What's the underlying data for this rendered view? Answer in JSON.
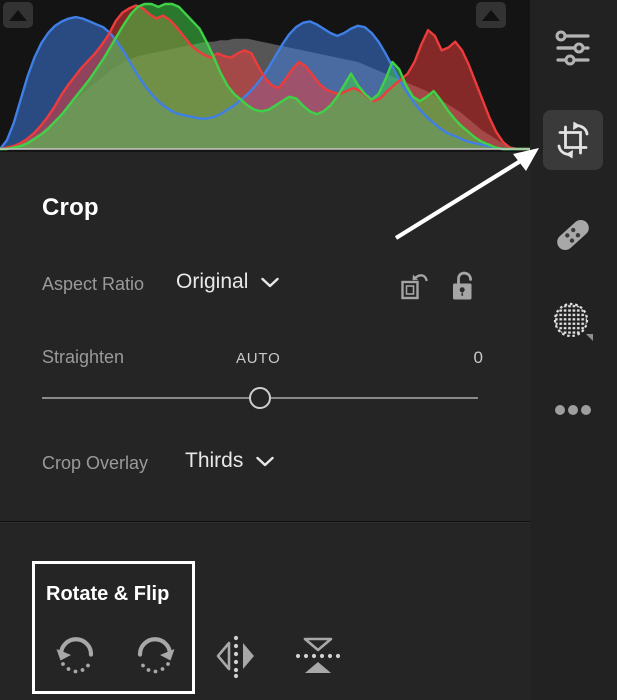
{
  "panel": {
    "title": "Crop",
    "aspect_ratio": {
      "label": "Aspect Ratio",
      "value": "Original",
      "chevron_icon": "chevron-down-icon",
      "rotate_aspect_icon": "rotate-aspect-icon",
      "lock_icon": "unlock-icon"
    },
    "straighten": {
      "label": "Straighten",
      "auto_label": "AUTO",
      "value": "0",
      "slider_position_pct": 50
    },
    "crop_overlay": {
      "label": "Crop Overlay",
      "value": "Thirds",
      "chevron_icon": "chevron-down-icon"
    },
    "rotate_flip": {
      "title": "Rotate & Flip",
      "buttons": [
        {
          "name": "rotate-counterclockwise-button",
          "icon": "rotate-ccw-icon"
        },
        {
          "name": "rotate-clockwise-button",
          "icon": "rotate-cw-icon"
        },
        {
          "name": "flip-horizontal-button",
          "icon": "flip-horizontal-icon"
        },
        {
          "name": "flip-vertical-button",
          "icon": "flip-vertical-icon"
        }
      ]
    }
  },
  "toolbar": {
    "items": [
      {
        "name": "edit-tool",
        "icon": "sliders-icon",
        "active": false
      },
      {
        "name": "crop-tool",
        "icon": "crop-rotate-icon",
        "active": true
      },
      {
        "name": "healing-tool",
        "icon": "bandage-icon",
        "active": false
      },
      {
        "name": "masking-tool",
        "icon": "halftone-circle-icon",
        "active": false
      },
      {
        "name": "more-tools",
        "icon": "ellipsis-icon",
        "active": false
      }
    ]
  },
  "histogram": {
    "shadow_clip_icon": "triangle-up-icon",
    "highlight_clip_icon": "triangle-up-icon"
  },
  "colors": {
    "panel_bg": "#252525",
    "histogram_bg": "#141414",
    "toolbar_bg": "#222222",
    "active_tool_bg": "#3a3a3a",
    "text_primary": "#e8e8e8",
    "text_secondary": "#9a9a9a",
    "accent_white": "#ffffff",
    "channel_red": "#ee3b3b",
    "channel_green": "#3fd247",
    "channel_blue": "#3f7fe6",
    "luminance_gray": "#8d8d8d"
  },
  "chart_data": {
    "type": "area",
    "title": "",
    "xlabel": "",
    "ylabel": "",
    "grid": false,
    "legend": "none",
    "xlim": [
      0,
      255
    ],
    "ylim": [
      0,
      100
    ],
    "series": [
      {
        "name": "Red",
        "color": "#ee3b3b",
        "values": [
          0,
          1,
          2,
          4,
          7,
          11,
          16,
          22,
          29,
          37,
          44,
          50,
          56,
          61,
          66,
          72,
          79,
          88,
          94,
          97,
          99,
          97,
          93,
          90,
          92,
          89,
          84,
          78,
          72,
          68,
          65,
          63,
          66,
          64,
          63,
          66,
          68,
          66,
          57,
          49,
          44,
          42,
          48,
          55,
          60,
          57,
          51,
          45,
          41,
          39,
          38,
          40,
          42,
          40,
          36,
          33,
          35,
          40,
          44,
          48,
          52,
          60,
          72,
          82,
          78,
          68,
          70,
          74,
          68,
          58,
          46,
          34,
          22,
          12,
          5,
          1,
          0,
          0,
          0
        ]
      },
      {
        "name": "Green",
        "color": "#3fd247",
        "values": [
          0,
          0,
          1,
          2,
          4,
          7,
          10,
          14,
          19,
          24,
          30,
          36,
          42,
          48,
          55,
          62,
          70,
          78,
          86,
          93,
          98,
          100,
          100,
          98,
          100,
          100,
          98,
          93,
          88,
          83,
          74,
          64,
          53,
          44,
          38,
          34,
          30,
          27,
          26,
          27,
          30,
          33,
          36,
          35,
          30,
          26,
          24,
          26,
          30,
          36,
          44,
          52,
          44,
          38,
          34,
          38,
          48,
          60,
          55,
          44,
          36,
          33,
          36,
          40,
          34,
          27,
          21,
          16,
          12,
          8,
          5,
          3,
          1,
          0,
          0,
          0,
          0,
          0
        ]
      },
      {
        "name": "Blue",
        "color": "#3f7fe6",
        "values": [
          0,
          6,
          18,
          34,
          50,
          63,
          73,
          80,
          85,
          88,
          90,
          91,
          90,
          88,
          86,
          84,
          80,
          74,
          67,
          59,
          51,
          44,
          38,
          33,
          29,
          26,
          24,
          23,
          22,
          21,
          21,
          22,
          24,
          27,
          30,
          34,
          38,
          43,
          49,
          56,
          64,
          72,
          79,
          84,
          87,
          88,
          86,
          83,
          80,
          78,
          80,
          83,
          85,
          84,
          80,
          74,
          66,
          57,
          48,
          40,
          33,
          27,
          22,
          18,
          14,
          11,
          9,
          7,
          5,
          4,
          3,
          2,
          1,
          0,
          0,
          0,
          0,
          0
        ]
      },
      {
        "name": "Luminance",
        "color": "#8d8d8d",
        "values": [
          0,
          1,
          2,
          4,
          6,
          9,
          12,
          16,
          20,
          25,
          30,
          34,
          38,
          42,
          46,
          50,
          54,
          57,
          60,
          62,
          64,
          65,
          66,
          67,
          68,
          69,
          70,
          71,
          72,
          73,
          74,
          74,
          75,
          75,
          76,
          76,
          76,
          75,
          74,
          73,
          72,
          71,
          70,
          69,
          68,
          67,
          66,
          65,
          64,
          63,
          62,
          61,
          60,
          58,
          56,
          54,
          52,
          50,
          48,
          46,
          44,
          42,
          40,
          37,
          34,
          31,
          28,
          25,
          21,
          17,
          13,
          10,
          7,
          4,
          2,
          1,
          0,
          0
        ]
      }
    ]
  }
}
